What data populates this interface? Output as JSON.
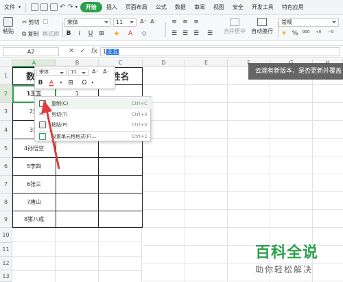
{
  "menubar": {
    "file": "文件",
    "tabs": [
      "开始",
      "插入",
      "页面布局",
      "公式",
      "数据",
      "审阅",
      "视图",
      "安全",
      "开发工具",
      "特色应用"
    ],
    "active_index": 0
  },
  "ribbon": {
    "paste": "粘贴",
    "cut": "剪切",
    "copy": "复制",
    "format_painter": "格式刷",
    "font_name": "宋体",
    "font_size": "11",
    "merge_center": "合并居中",
    "wrap_text": "自动换行",
    "number_format": "常规"
  },
  "formula_bar": {
    "name_box": "A2",
    "value_prefix": "1",
    "value_selected": "王五"
  },
  "columns": [
    "A",
    "B",
    "C",
    "D",
    "E",
    "F",
    "G",
    "H"
  ],
  "rows": [
    "1",
    "2",
    "3",
    "4",
    "5",
    "6",
    "7",
    "8",
    "9",
    "10",
    "11",
    "12",
    "13"
  ],
  "table": {
    "header_a": "数",
    "header_c": "姓名",
    "b2": "1",
    "a_values": [
      "1王五",
      "2刘",
      "3刘",
      "4孙悟空",
      "5李四",
      "6张三",
      "7唐山",
      "8猪八戒"
    ]
  },
  "mini_toolbar": {
    "font_name": "宋体",
    "font_size": "11",
    "bold": "B",
    "font_color": "A",
    "symbol": "Ω"
  },
  "context_menu": [
    {
      "label": "复制(C)",
      "shortcut": "Ctrl+C"
    },
    {
      "label": "剪切(T)",
      "shortcut": "Ctrl+X"
    },
    {
      "label": "粘贴(P)",
      "shortcut": "Ctrl+V"
    },
    {
      "label": "设置单元格格式(F)...",
      "shortcut": "Ctrl+1"
    }
  ],
  "notice": "云端有新版本，是否更新并覆盖",
  "watermark": {
    "title": "百科全说",
    "subtitle": "助你轻松解决"
  },
  "colors": {
    "accent": "#2aa14a",
    "arrow": "#e03a3a"
  }
}
